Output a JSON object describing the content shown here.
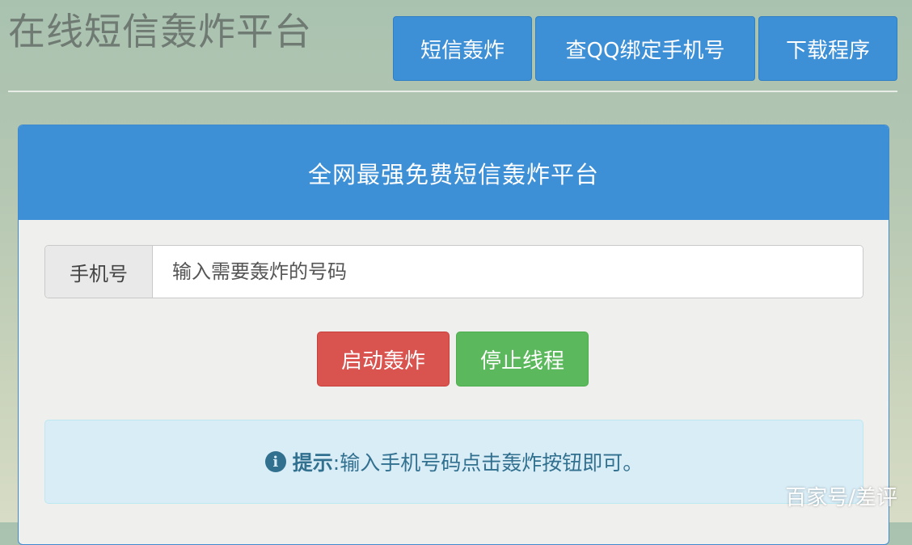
{
  "header": {
    "site_title": "在线短信轰炸平台",
    "nav": [
      {
        "label": "短信轰炸"
      },
      {
        "label": "查QQ绑定手机号"
      },
      {
        "label": "下载程序"
      }
    ]
  },
  "panel": {
    "title": "全网最强免费短信轰炸平台",
    "phone_label": "手机号",
    "phone_value": "",
    "phone_placeholder": "输入需要轰炸的号码",
    "start_button": "启动轰炸",
    "stop_button": "停止线程",
    "tip_label": "提示",
    "tip_text": ":输入手机号码点击轰炸按钮即可。",
    "tip_icon": "info-circle-icon"
  },
  "watermark": "百家号/差评",
  "colors": {
    "primary": "#3d8fd6",
    "danger": "#d9534f",
    "success": "#5cb85c",
    "info_bg": "#d9edf7",
    "info_text": "#31708f"
  }
}
